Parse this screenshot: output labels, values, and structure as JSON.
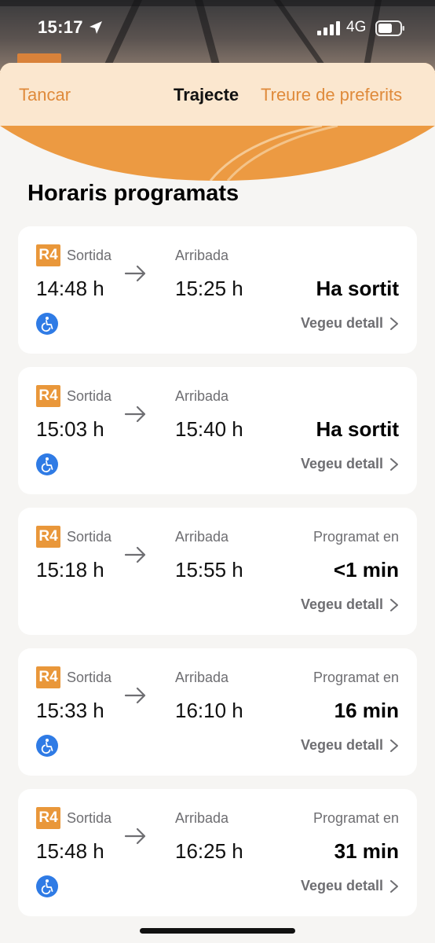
{
  "status_bar": {
    "time": "15:17",
    "network": "4G",
    "icons": [
      "location-arrow-icon",
      "cellular-signal-icon",
      "battery-icon"
    ]
  },
  "nav": {
    "close_label": "Tancar",
    "title": "Trajecte",
    "unfavorite_label": "Treure de preferits"
  },
  "colors": {
    "accent": "#df8a3a",
    "badge": "#e9973a",
    "accessibility": "#2f7be5",
    "nav_bg": "#fbe7cf"
  },
  "section_title": "Horaris programats",
  "trips": [
    {
      "line": "R4",
      "departure_label": "Sortida",
      "departure_time": "14:48 h",
      "arrival_label": "Arribada",
      "arrival_time": "15:25 h",
      "status_label": "",
      "status_value": "Ha sortit",
      "accessible": true,
      "detail_label": "Vegeu detall"
    },
    {
      "line": "R4",
      "departure_label": "Sortida",
      "departure_time": "15:03 h",
      "arrival_label": "Arribada",
      "arrival_time": "15:40 h",
      "status_label": "",
      "status_value": "Ha sortit",
      "accessible": true,
      "detail_label": "Vegeu detall"
    },
    {
      "line": "R4",
      "departure_label": "Sortida",
      "departure_time": "15:18 h",
      "arrival_label": "Arribada",
      "arrival_time": "15:55 h",
      "status_label": "Programat en",
      "status_value": "<1 min",
      "accessible": false,
      "detail_label": "Vegeu detall"
    },
    {
      "line": "R4",
      "departure_label": "Sortida",
      "departure_time": "15:33 h",
      "arrival_label": "Arribada",
      "arrival_time": "16:10 h",
      "status_label": "Programat en",
      "status_value": "16 min",
      "accessible": true,
      "detail_label": "Vegeu detall"
    },
    {
      "line": "R4",
      "departure_label": "Sortida",
      "departure_time": "15:48 h",
      "arrival_label": "Arribada",
      "arrival_time": "16:25 h",
      "status_label": "Programat en",
      "status_value": "31 min",
      "accessible": true,
      "detail_label": "Vegeu detall"
    }
  ]
}
